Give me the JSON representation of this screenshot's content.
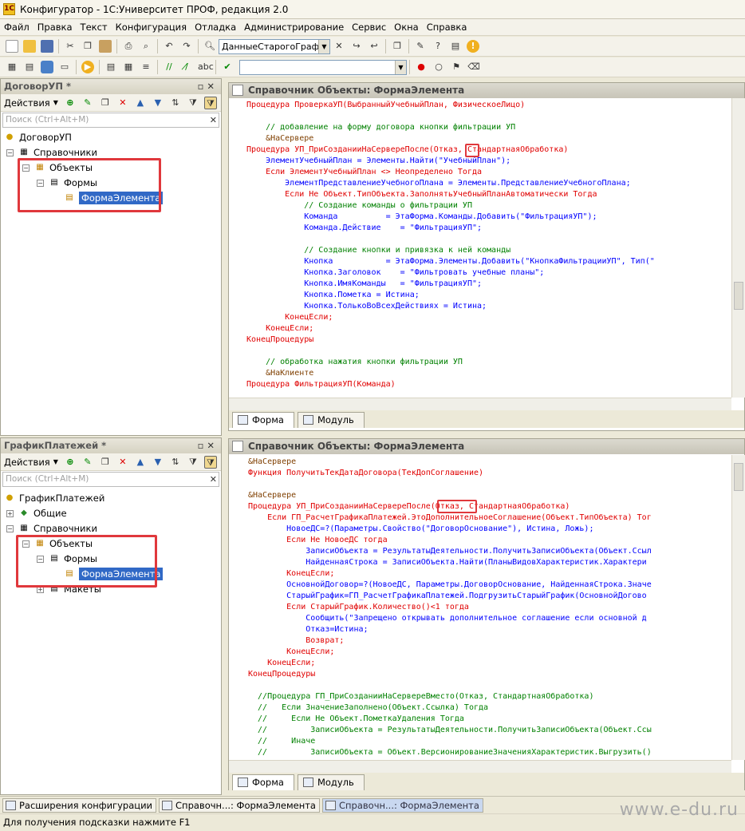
{
  "app": {
    "title": "Конфигуратор - 1С:Университет ПРОФ, редакция 2.0"
  },
  "menu": [
    "Файл",
    "Правка",
    "Текст",
    "Конфигурация",
    "Отладка",
    "Администрирование",
    "Сервис",
    "Окна",
    "Справка"
  ],
  "toolbar": {
    "search_combo": "ДанныеСтарогоГрафи"
  },
  "left_top": {
    "title": "ДоговорУП *",
    "actions": "Действия",
    "search_placeholder": "Поиск (Ctrl+Alt+M)",
    "tree": [
      "ДоговорУП",
      "Справочники",
      "Объекты",
      "Формы",
      "ФормаЭлемента"
    ]
  },
  "left_bottom": {
    "title": "ГрафикПлатежей *",
    "actions": "Действия",
    "search_placeholder": "Поиск (Ctrl+Alt+M)",
    "tree": [
      "ГрафикПлатежей",
      "Общие",
      "Справочники",
      "Объекты",
      "Формы",
      "ФормаЭлемента",
      "Макеты"
    ]
  },
  "editor_top": {
    "title": "Справочник Объекты: ФормаЭлемента",
    "tabs": [
      "Форма",
      "Модуль"
    ],
    "lines": [
      "Процедура ПроверкаУП(ВыбранныйУчебныйПлан, ФизическоеЛицо)",
      "",
      "    // добавление на форму договора кнопки фильтрации УП",
      "    &НаСервере",
      "Процедура УП_ПриСозданииНаСервереПосле(Отказ, СтандартнаяОбработка)",
      "    ЭлементУчебныйПлан = Элементы.Найти(\"УчебныйПлан\");",
      "    Если ЭлементУчебныйПлан <> Неопределено Тогда",
      "        ЭлементПредставлениеУчебногоПлана = Элементы.ПредставлениеУчебногоПлана;",
      "        Если Не Объект.ТипОбъекта.ЗаполнятьУчебныйПланАвтоматически Тогда",
      "            // Создание команды о фильтрации УП",
      "            Команда          = ЭтаФорма.Команды.Добавить(\"ФильтрацияУП\");",
      "            Команда.Действие    = \"ФильтрацияУП\";",
      "",
      "            // Создание кнопки и привязка к ней команды",
      "            Кнопка           = ЭтаФорма.Элементы.Добавить(\"КнопкаФильтрацииУП\", Тип(\"",
      "            Кнопка.Заголовок    = \"Фильтровать учебные планы\";",
      "            Кнопка.ИмяКоманды   = \"ФильтрацияУП\";",
      "            Кнопка.Пометка = Истина;",
      "            Кнопка.ТолькоВоВсехДействиях = Истина;",
      "        КонецЕсли;",
      "    КонецЕсли;",
      "КонецПроцедуры",
      "",
      "    // обработка нажатия кнопки фильтрации УП",
      "    &НаКлиенте",
      "Процедура ФильтрацияУП(Команда)"
    ]
  },
  "editor_bottom": {
    "title": "Справочник Объекты: ФормаЭлемента",
    "tabs": [
      "Форма",
      "Модуль"
    ],
    "lines": [
      "&НаСервере",
      "Функция ПолучитьТекДатаДоговора(ТекДопСоглашение)",
      "",
      "&НаСервере",
      "Процедура УП_ПриСозданииНаСервереПосле(Отказ, СтандартнаяОбработка)",
      "    Если ГП_РасчетГрафикаПлатежей.ЭтоДополнительноеСоглашение(Объект.ТипОбъекта) Тог",
      "        НовоеДС=?(Параметры.Свойство(\"ДоговорОснование\"), Истина, Ложь);",
      "        Если Не НовоеДС тогда",
      "            ЗаписиОбъекта = РезультатыДеятельности.ПолучитьЗаписиОбъекта(Объект.Ссыл",
      "            НайденнаяСтрока = ЗаписиОбъекта.Найти(ПланыВидовХарактеристик.Характери",
      "        КонецЕсли;",
      "        ОсновнойДоговор=?(НовоеДС, Параметры.ДоговорОснование, НайденнаяСтрока.Значе",
      "        СтарыйГрафик=ГП_РасчетГрафикаПлатежей.ПодгрузитьСтарыйГрафик(ОсновнойДогово",
      "        Если СтарыйГрафик.Количество()<1 тогда",
      "            Сообщить(\"Запрещено открывать дополнительное соглашение если основной д",
      "            Отказ=Истина;",
      "            Возврат;",
      "        КонецЕсли;",
      "    КонецЕсли;",
      "КонецПроцедуры",
      "",
      "  //Процедура ГП_ПриСозданииНаСервереВместо(Отказ, СтандартнаяОбработка)",
      "  //   Если ЗначениеЗаполнено(Объект.Ссылка) Тогда",
      "  //     Если Не Объект.ПометкаУдаления Тогда",
      "  //         ЗаписиОбъекта = РезультатыДеятельности.ПолучитьЗаписиОбъекта(Объект.Ссы",
      "  //     Иначе",
      "  //         ЗаписиОбъекта = Объект.ВерсионированиеЗначенияХарактеристик.Выгрузить()"
    ]
  },
  "taskbar": [
    "Расширения конфигурации",
    "Справочн...: ФормаЭлемента",
    "Справочн...: ФормаЭлемента"
  ],
  "status": "Для получения подсказки нажмите F1",
  "watermark": "www.e-du.ru"
}
